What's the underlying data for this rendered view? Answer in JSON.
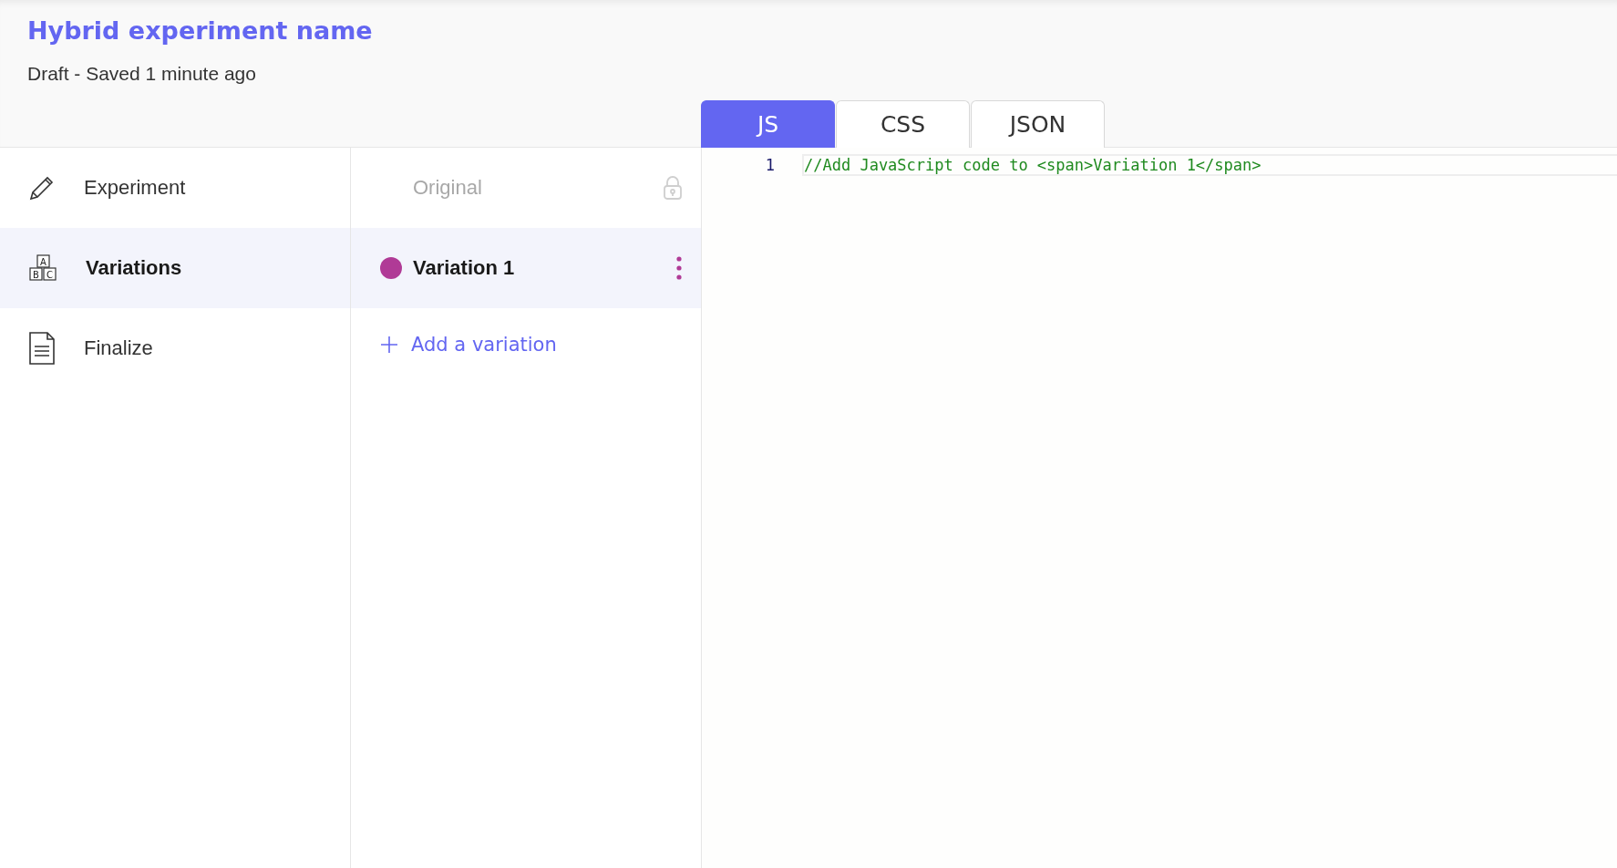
{
  "header": {
    "title": "Hybrid experiment name",
    "status": "Draft - Saved 1 minute ago"
  },
  "tabs": [
    {
      "label": "JS",
      "selected": true
    },
    {
      "label": "CSS",
      "selected": false
    },
    {
      "label": "JSON",
      "selected": false
    }
  ],
  "sidebar": {
    "items": [
      {
        "label": "Experiment",
        "kind": "pencil",
        "selected": false
      },
      {
        "label": "Variations",
        "kind": "blocks",
        "selected": true,
        "icon_letters": [
          "A",
          "B",
          "C"
        ]
      },
      {
        "label": "Finalize",
        "kind": "document",
        "selected": false
      }
    ]
  },
  "variations": {
    "items": [
      {
        "label": "Original",
        "disabled": true,
        "selected": false
      },
      {
        "label": "Variation 1",
        "disabled": false,
        "selected": true,
        "color": "#b03a96"
      }
    ],
    "add_label": "Add a variation"
  },
  "editor": {
    "lines": [
      {
        "number": "1",
        "code": "//Add JavaScript code to <span>Variation 1</span>"
      }
    ]
  }
}
